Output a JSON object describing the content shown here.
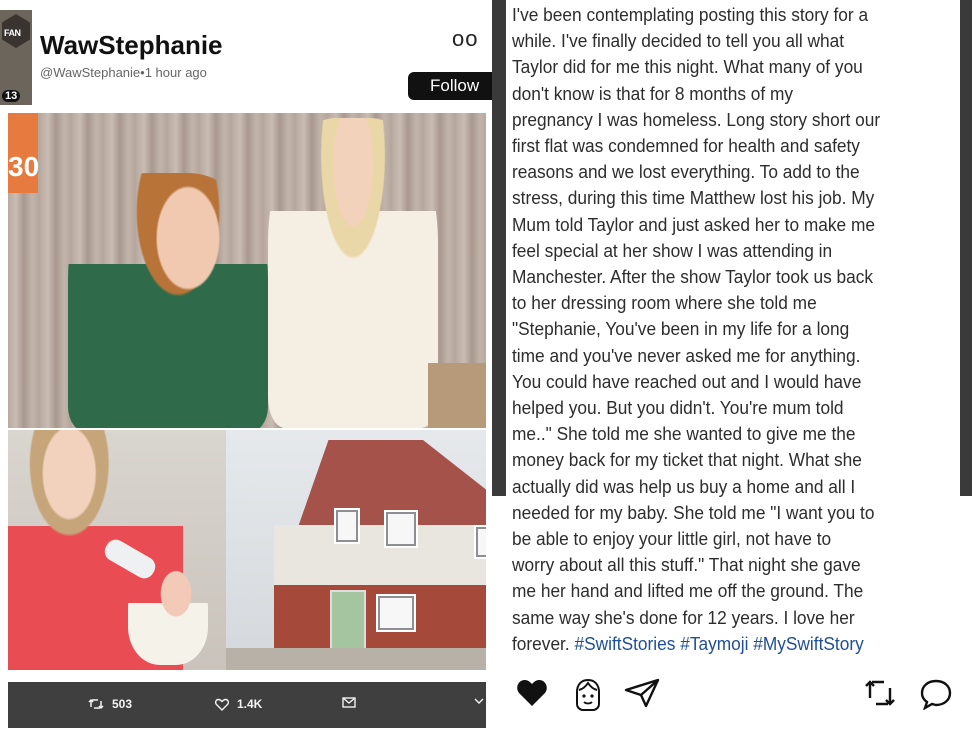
{
  "tweet": {
    "avatar_badge_text": "FAN",
    "avatar_number": "13",
    "display_name": "WawStephanie",
    "handle": "@WawStephanie",
    "separator": "•",
    "time": "1 hour ago",
    "more_label": "oo",
    "follow_label": "Follow",
    "photo_overlay_text": "30",
    "retweets": "503",
    "likes": "1.4K"
  },
  "instagram": {
    "caption_lines": [
      "I've been contemplating posting this story for a",
      "while. I've finally decided to tell you all what",
      "Taylor did for me this night. What many of you",
      "don't know is that for 8 months of my",
      "pregnancy I was homeless. Long story short our",
      "first flat was condemned for health and safety",
      "reasons and we lost everything. To add to the",
      "stress, during this time Matthew lost his job. My",
      "Mum told Taylor and just asked her to make me",
      "feel special at her show I was attending in",
      "Manchester. After the show Taylor took us back",
      "to her dressing room where she told me",
      "\"Stephanie, You've been in my life for a long",
      "time and you've never asked me for anything.",
      "You could have reached out and I would have",
      "helped you. But you didn't. You're mum told",
      "me..\" She told me she wanted to give me the",
      "money back for my ticket that night. What she",
      "actually did was help us buy a home and all I",
      "needed for my baby. She told me \"I want you to",
      "be able to enjoy your little girl, not have to",
      "worry about all this stuff.\" That night she gave",
      "me her hand and lifted me off the ground. The",
      "same way she's done for 12 years. I love her"
    ],
    "last_line_text": "forever.",
    "hashtags": "#SwiftStories #Taymoji #MySwiftStory"
  },
  "icons": [
    "retweet-icon",
    "heart-outline-icon",
    "mail-icon",
    "chevron-icon",
    "heart-filled-icon",
    "taymoji-face-icon",
    "send-icon",
    "repost-icon",
    "comment-bubble-icon"
  ],
  "colors": {
    "hashtag": "#1f4f98",
    "action_bar": "#3f3f3f",
    "caption_text": "#2d2d2d"
  }
}
